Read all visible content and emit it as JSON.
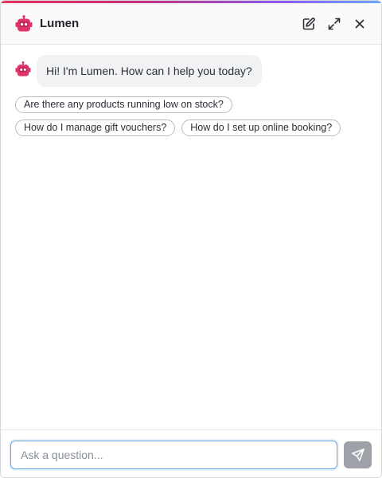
{
  "header": {
    "title": "Lumen",
    "actions": {
      "new_chat_icon": "edit-icon",
      "expand_icon": "expand-icon",
      "close_icon": "close-icon"
    }
  },
  "messages": [
    {
      "role": "bot",
      "text": "Hi! I'm Lumen. How can I help you today?"
    }
  ],
  "suggestions": [
    "Are there any products running low on stock?",
    "How do I manage gift vouchers?",
    "How do I set up online booking?"
  ],
  "composer": {
    "placeholder": "Ask a question...",
    "send_icon": "send-icon"
  },
  "colors": {
    "brand": "#e0356a",
    "bubble_bg": "#f1f2f4",
    "send_disabled": "#9ea2a8",
    "input_focus": "#6aa4e8"
  }
}
